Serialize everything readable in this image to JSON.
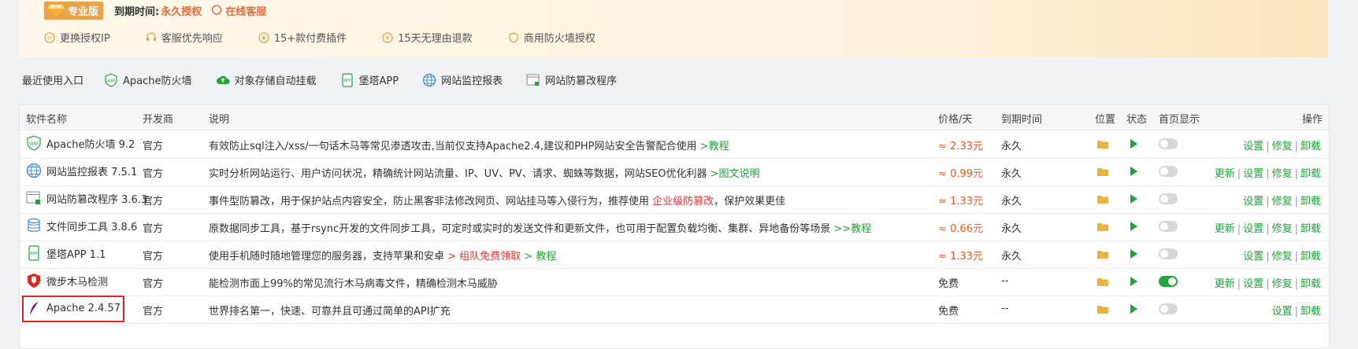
{
  "banner": {
    "edition": "专业版",
    "expire_label": "到期时间:",
    "expire_value": "永久授权",
    "service": "在线客服",
    "perks": [
      "更换授权IP",
      "客服优先响应",
      "15+款付费插件",
      "15天无理由退款",
      "商用防火墙授权"
    ]
  },
  "quick": {
    "label": "最近使用入口",
    "items": [
      "Apache防火墙",
      "对象存储自动挂载",
      "堡塔APP",
      "网站监控报表",
      "网站防篡改程序"
    ]
  },
  "table": {
    "headers": {
      "name": "软件名称",
      "dev": "开发商",
      "desc": "说明",
      "price": "价格/天",
      "expire": "到期时间",
      "location": "位置",
      "status": "状态",
      "home": "首页显示",
      "ops": "操作"
    },
    "rows": [
      {
        "name": "Apache防火墙 9.2",
        "dev": "官方",
        "desc": "有效防止sql注入/xss/一句话木马等常见渗透攻击,当前仅支持Apache2.4,建议和PHP网站安全告警配合使用 ",
        "desc_link": ">教程",
        "desc_red": "",
        "desc_tail": "",
        "price": "≈ 2.33元",
        "expire": "永久",
        "home_on": false,
        "ops": [
          "设置",
          "修复",
          "卸载"
        ]
      },
      {
        "name": "网站监控报表 7.5.1",
        "dev": "官方",
        "desc": "实时分析网站运行、用户访问状况，精确统计网站流量、IP、UV、PV、请求、蜘蛛等数据，网站SEO优化利器 ",
        "desc_link": ">图文说明",
        "desc_red": "",
        "desc_tail": "",
        "price": "≈ 0.99元",
        "expire": "永久",
        "home_on": false,
        "ops": [
          "更新",
          "设置",
          "修复",
          "卸载"
        ]
      },
      {
        "name": "网站防篡改程序 3.6.3",
        "dev": "官方",
        "desc": "事件型防篡改，用于保护站点内容安全，防止黑客非法修改网页、网站挂马等入侵行为，推荐使用 ",
        "desc_link": "",
        "desc_red": "企业级防篡改",
        "desc_tail": "，保护效果更佳",
        "price": "≈ 1.33元",
        "expire": "永久",
        "home_on": false,
        "ops": [
          "设置",
          "修复",
          "卸载"
        ]
      },
      {
        "name": "文件同步工具 3.8.6",
        "dev": "官方",
        "desc": "原数据同步工具，基于rsync开发的文件同步工具，可定时或实时的发送文件和更新文件，也可用于配置负载均衡、集群、异地备份等场景 ",
        "desc_link": ">>教程",
        "desc_red": "",
        "desc_tail": "",
        "price": "≈ 0.66元",
        "expire": "永久",
        "home_on": false,
        "ops": [
          "更新",
          "设置",
          "修复",
          "卸载"
        ]
      },
      {
        "name": "堡塔APP 1.1",
        "dev": "官方",
        "desc": "使用手机随时随地管理您的服务器，支持苹果和安卓 ",
        "desc_link": "",
        "desc_red": "> 组队免费领取",
        "desc_tail": " > 教程",
        "price": "≈ 1.33元",
        "expire": "永久",
        "home_on": false,
        "ops": [
          "设置",
          "修复",
          "卸载"
        ]
      },
      {
        "name": "微步木马检测",
        "dev": "官方",
        "desc": "能检测市面上99%的常见流行木马病毒文件，精确检测木马威胁",
        "desc_link": "",
        "desc_red": "",
        "desc_tail": "",
        "price": "免费",
        "expire": "--",
        "home_on": true,
        "ops": [
          "更新",
          "设置",
          "修复",
          "卸载"
        ]
      },
      {
        "name": "Apache 2.4.57",
        "dev": "官方",
        "desc": "世界排名第一，快速、可靠并且可通过简单的API扩充",
        "desc_link": "",
        "desc_red": "",
        "desc_tail": "",
        "price": "免费",
        "expire": "--",
        "home_on": false,
        "ops": [
          "设置",
          "卸载"
        ]
      }
    ]
  },
  "colors": {
    "accent": "#20a53a",
    "price": "#ff5722",
    "highlight": "#e1251b",
    "pro": "#e8a34d"
  }
}
